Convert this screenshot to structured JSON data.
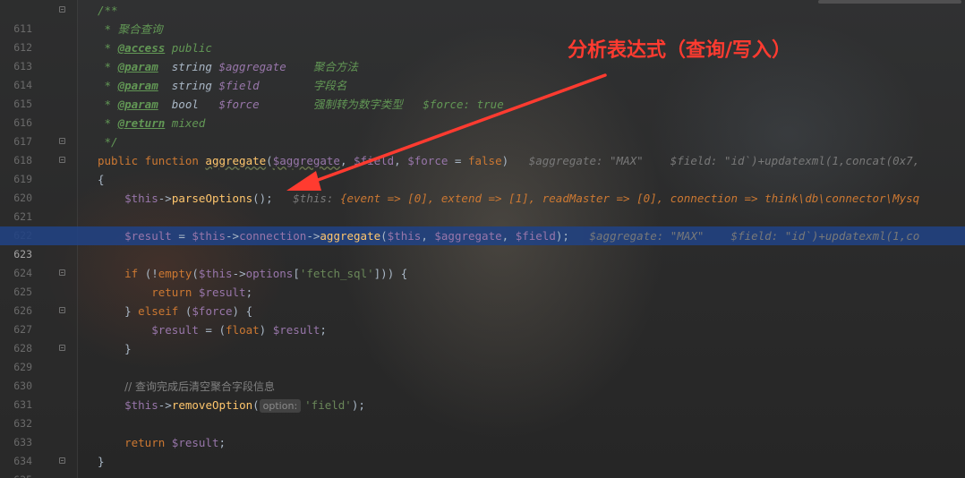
{
  "annotation": {
    "title": "分析表达式（查询/写入）",
    "color": "#ff3b30"
  },
  "colors": {
    "background": "#2b2b2b",
    "current_line": "#214283",
    "keyword": "#cc7832",
    "variable": "#9876aa",
    "function": "#ffc66d",
    "string": "#6a8759",
    "docblock": "#629755",
    "comment": "#808080"
  },
  "lines": [
    {
      "n": "611",
      "t": "/**"
    },
    {
      "n": "612",
      "t": " * 聚合查询"
    },
    {
      "n": "613",
      "tag": "@access",
      "rest": " public"
    },
    {
      "n": "614",
      "tag": "@param",
      "type": "  string ",
      "var": "$aggregate",
      "desc": "    聚合方法"
    },
    {
      "n": "615",
      "tag": "@param",
      "type": "  string ",
      "var": "$field",
      "desc": "        字段名"
    },
    {
      "n": "616",
      "tag": "@param",
      "type": "  bool   ",
      "var": "$force",
      "desc": "        强制转为数字类型   $force: true"
    },
    {
      "n": "617",
      "tag": "@return",
      "rest": " mixed"
    },
    {
      "n": "618",
      "t": " */"
    },
    {
      "n": "619",
      "hint1": "$aggregate: \"MAX\"",
      "hint2": "$field: \"id`)+updatexml(1,concat(0x7,"
    },
    {
      "n": "620",
      "t": "{"
    },
    {
      "n": "621",
      "hintlabel": "$this:",
      "hintval": "{event => [0], extend => [1], readMaster => [0], connection => think\\db\\connector\\Mysq"
    },
    {
      "n": "622"
    },
    {
      "n": "623",
      "hint1": "$aggregate: \"MAX\"",
      "hint2": "$field: \"id`)+updatexml(1,co"
    },
    {
      "n": "624"
    },
    {
      "n": "625",
      "str": "'fetch_sql'"
    },
    {
      "n": "626"
    },
    {
      "n": "627"
    },
    {
      "n": "628"
    },
    {
      "n": "629"
    },
    {
      "n": "630"
    },
    {
      "n": "631",
      "t": "// 查询完成后清空聚合字段信息"
    },
    {
      "n": "632",
      "chip": "option:",
      "str": "'field'"
    },
    {
      "n": "633"
    },
    {
      "n": "634"
    },
    {
      "n": "635"
    }
  ]
}
